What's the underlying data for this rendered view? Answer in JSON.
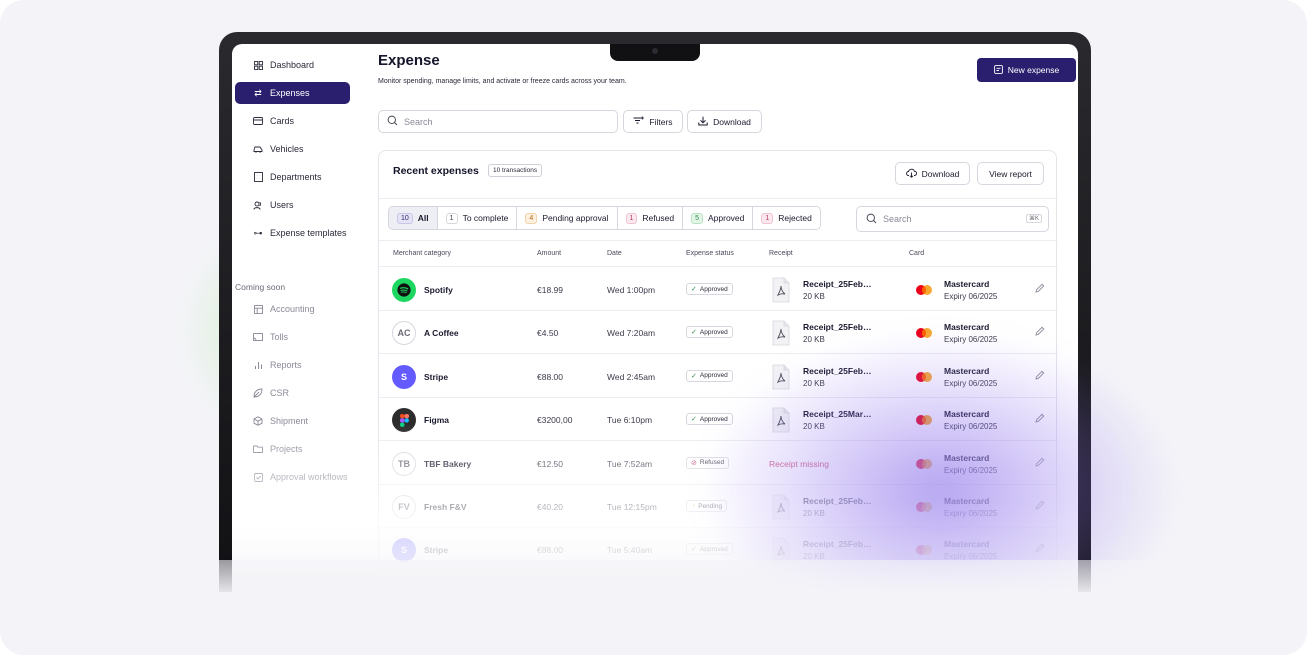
{
  "sidebar": {
    "items": [
      {
        "label": "Dashboard",
        "icon": "grid-icon"
      },
      {
        "label": "Expenses",
        "icon": "arrows-swap-icon",
        "active": true
      },
      {
        "label": "Cards",
        "icon": "credit-card-icon"
      },
      {
        "label": "Vehicles",
        "icon": "car-icon"
      },
      {
        "label": "Departments",
        "icon": "building-icon"
      },
      {
        "label": "Users",
        "icon": "users-icon"
      },
      {
        "label": "Expense templates",
        "icon": "template-icon"
      }
    ],
    "coming_soon_label": "Coming soon",
    "soon_items": [
      {
        "label": "Accounting",
        "icon": "table-icon"
      },
      {
        "label": "Tolls",
        "icon": "toll-icon"
      },
      {
        "label": "Reports",
        "icon": "bar-chart-icon"
      },
      {
        "label": "CSR",
        "icon": "leaf-icon"
      },
      {
        "label": "Shipment",
        "icon": "box-icon"
      },
      {
        "label": "Projects",
        "icon": "folder-icon"
      },
      {
        "label": "Approval workflows",
        "icon": "checklist-icon"
      }
    ]
  },
  "header": {
    "title": "Expense",
    "subtitle": "Monitor spending, manage limits, and activate or freeze cards across your team.",
    "new_expense_label": "New expense"
  },
  "toolbar": {
    "search_placeholder": "Search",
    "filters_label": "Filters",
    "download_label": "Download"
  },
  "recent": {
    "title": "Recent expenses",
    "count_badge": "10 transactions",
    "download_label": "Download",
    "view_report_label": "View report",
    "search_placeholder": "Search",
    "search_shortcut": "⌘K",
    "tabs": [
      {
        "count": "10",
        "label": "All"
      },
      {
        "count": "1",
        "label": "To complete"
      },
      {
        "count": "4",
        "label": "Pending approval"
      },
      {
        "count": "1",
        "label": "Refused"
      },
      {
        "count": "5",
        "label": "Approved"
      },
      {
        "count": "1",
        "label": "Rejected"
      }
    ],
    "columns": [
      "Merchant category",
      "Amount",
      "Date",
      "Expense status",
      "Receipt",
      "Card"
    ],
    "rows": [
      {
        "merchant": "Spotify",
        "avatar": "",
        "avatar_color": "#1ed760",
        "amount": "€18.99",
        "date": "Wed 1:00pm",
        "status": "Approved",
        "receipt": "Receipt_25Feb…",
        "size": "20 KB",
        "card": "Mastercard",
        "expiry": "Expiry 06/2025"
      },
      {
        "merchant": "A Coffee",
        "avatar": "AC",
        "avatar_color": "#ffffff",
        "amount": "€4.50",
        "date": "Wed 7:20am",
        "status": "Approved",
        "receipt": "Receipt_25Feb…",
        "size": "20 KB",
        "card": "Mastercard",
        "expiry": "Expiry 06/2025"
      },
      {
        "merchant": "Stripe",
        "avatar": "S",
        "avatar_color": "#635bff",
        "amount": "€88.00",
        "date": "Wed 2:45am",
        "status": "Approved",
        "receipt": "Receipt_25Feb…",
        "size": "20 KB",
        "card": "Mastercard",
        "expiry": "Expiry 06/2025"
      },
      {
        "merchant": "Figma",
        "avatar": "",
        "avatar_color": "#2c2c2c",
        "amount": "€3200,00",
        "date": "Tue 6:10pm",
        "status": "Approved",
        "receipt": "Receipt_25Mar…",
        "size": "20 KB",
        "card": "Mastercard",
        "expiry": "Expiry 06/2025"
      },
      {
        "merchant": "TBF Bakery",
        "avatar": "TB",
        "avatar_color": "#ffffff",
        "amount": "€12.50",
        "date": "Tue 7:52am",
        "status": "Refused",
        "receipt_missing": "Receipt missing",
        "card": "Mastercard",
        "expiry": "Expiry 06/2025"
      },
      {
        "merchant": "Fresh F&V",
        "avatar": "FV",
        "avatar_color": "#ffffff",
        "amount": "€40.20",
        "date": "Tue 12:15pm",
        "status": "Pending",
        "receipt": "Receipt_25Feb…",
        "size": "20 KB",
        "card": "Mastercard",
        "expiry": "Expiry 06/2025"
      },
      {
        "merchant": "Stripe",
        "avatar": "S",
        "avatar_color": "#635bff",
        "amount": "€88.00",
        "date": "Tue 5:40am",
        "status": "Approved",
        "receipt": "Receipt_25Feb…",
        "size": "20 KB",
        "card": "Mastercard",
        "expiry": "Expiry 06/2025"
      }
    ]
  },
  "colors": {
    "accent": "#2a1f6e",
    "approved": "#2f8a4b",
    "refused": "#c0306a",
    "pending": "#e0a040"
  }
}
